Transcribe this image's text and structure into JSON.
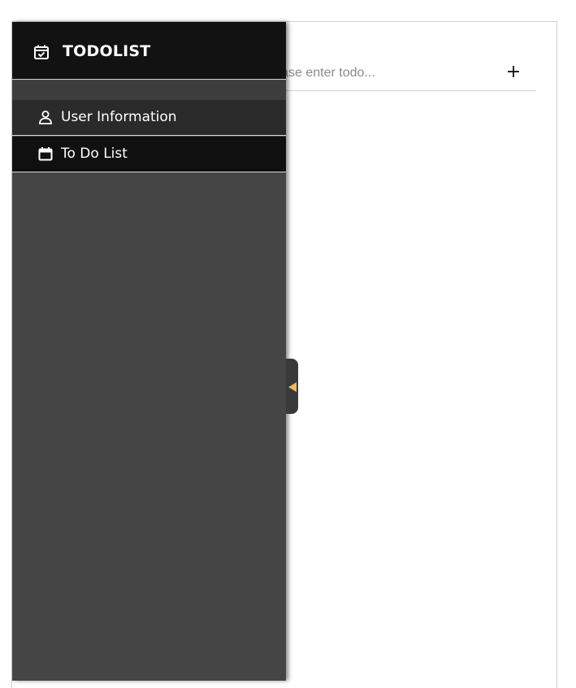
{
  "app": {
    "title": "TODOLIST",
    "accent_color": "#f0b860",
    "sidebar_bg": "#454545",
    "header_bg": "#121212"
  },
  "todo": {
    "input_placeholder": "Please enter todo...",
    "input_value": "",
    "add_label": "+"
  },
  "sidebar": {
    "brand_icon": "calendar-check-icon",
    "items": [
      {
        "label": "User Information",
        "icon": "user-icon",
        "active": true
      },
      {
        "label": "To Do List",
        "icon": "calendar-icon",
        "active": false
      }
    ],
    "collapse_icon": "caret-left-icon"
  }
}
